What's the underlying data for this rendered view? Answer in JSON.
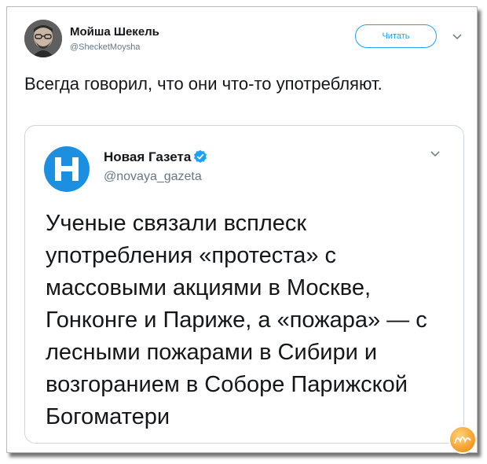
{
  "tweet": {
    "author_name": "Мойша Шекель",
    "author_handle": "@ShecketMoysha",
    "follow_label": "Читать",
    "text": "Всегда говорил, что они что-то употребляют."
  },
  "quoted_tweet": {
    "author_name": "Новая Газета",
    "author_handle": "@novaya_gazeta",
    "verified": true,
    "text": "Ученые связали всплеск употребления «протеста» с массовыми акциями в Москве, Гонконге и Париже, а «пожара» — с лесными пожарами в Сибири и возгоранием в Соборе Парижской Богоматери"
  },
  "icons": {
    "menu_caret": "chevron-down-icon",
    "verified": "verified-badge-icon",
    "logo": "novaya-gazeta-logo-icon",
    "watermark": "nyka-watermark-icon"
  },
  "colors": {
    "accent": "#1da1f2",
    "text": "#14171a",
    "muted": "#657786",
    "border": "#ccd6dd",
    "logo_blue": "#1d8fe0"
  }
}
